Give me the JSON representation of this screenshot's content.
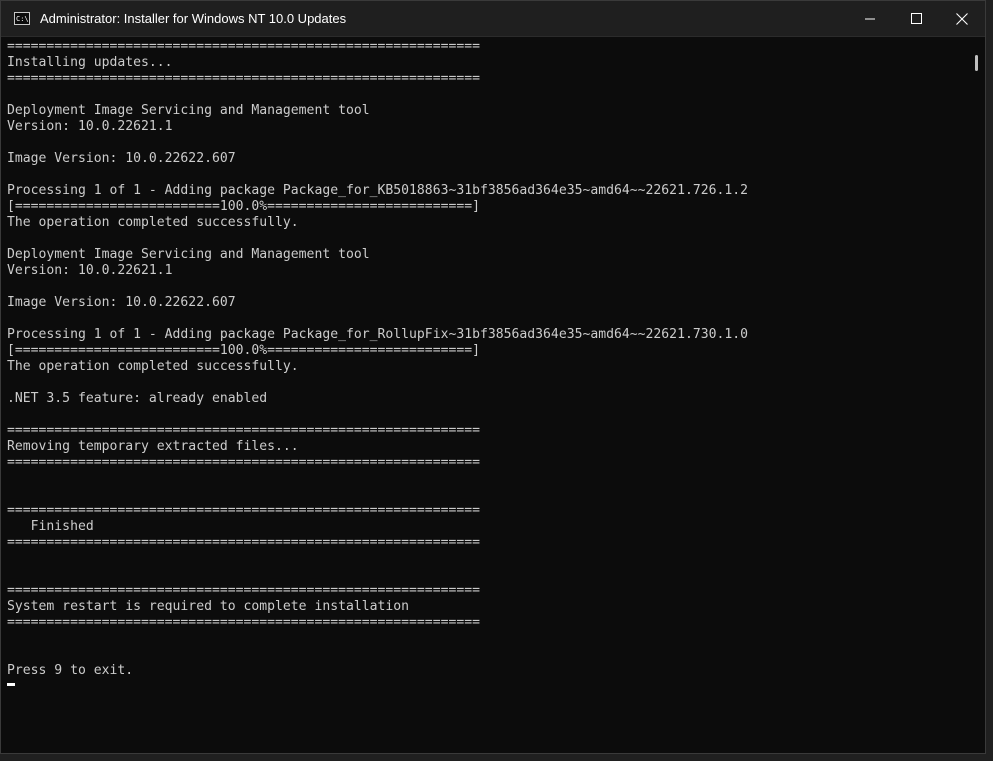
{
  "window": {
    "title": "Administrator:  Installer for Windows NT 10.0 Updates",
    "icon": "cmd-icon",
    "icon_text": "C:\\"
  },
  "controls": {
    "minimize_icon": "minimize-icon",
    "maximize_icon": "maximize-icon",
    "close_icon": "close-icon"
  },
  "console": {
    "lines": [
      "============================================================",
      "Installing updates...",
      "============================================================",
      "",
      "Deployment Image Servicing and Management tool",
      "Version: 10.0.22621.1",
      "",
      "Image Version: 10.0.22622.607",
      "",
      "Processing 1 of 1 - Adding package Package_for_KB5018863~31bf3856ad364e35~amd64~~22621.726.1.2",
      "[==========================100.0%==========================]",
      "The operation completed successfully.",
      "",
      "Deployment Image Servicing and Management tool",
      "Version: 10.0.22621.1",
      "",
      "Image Version: 10.0.22622.607",
      "",
      "Processing 1 of 1 - Adding package Package_for_RollupFix~31bf3856ad364e35~amd64~~22621.730.1.0",
      "[==========================100.0%==========================]",
      "The operation completed successfully.",
      "",
      ".NET 3.5 feature: already enabled",
      "",
      "============================================================",
      "Removing temporary extracted files...",
      "============================================================",
      "",
      "",
      "============================================================",
      "   Finished",
      "============================================================",
      "",
      "",
      "============================================================",
      "System restart is required to complete installation",
      "============================================================",
      "",
      "",
      "Press 9 to exit."
    ]
  },
  "colors": {
    "console_bg": "#0c0c0c",
    "console_text": "#cccccc",
    "titlebar_bg": "#1f1f1f"
  }
}
